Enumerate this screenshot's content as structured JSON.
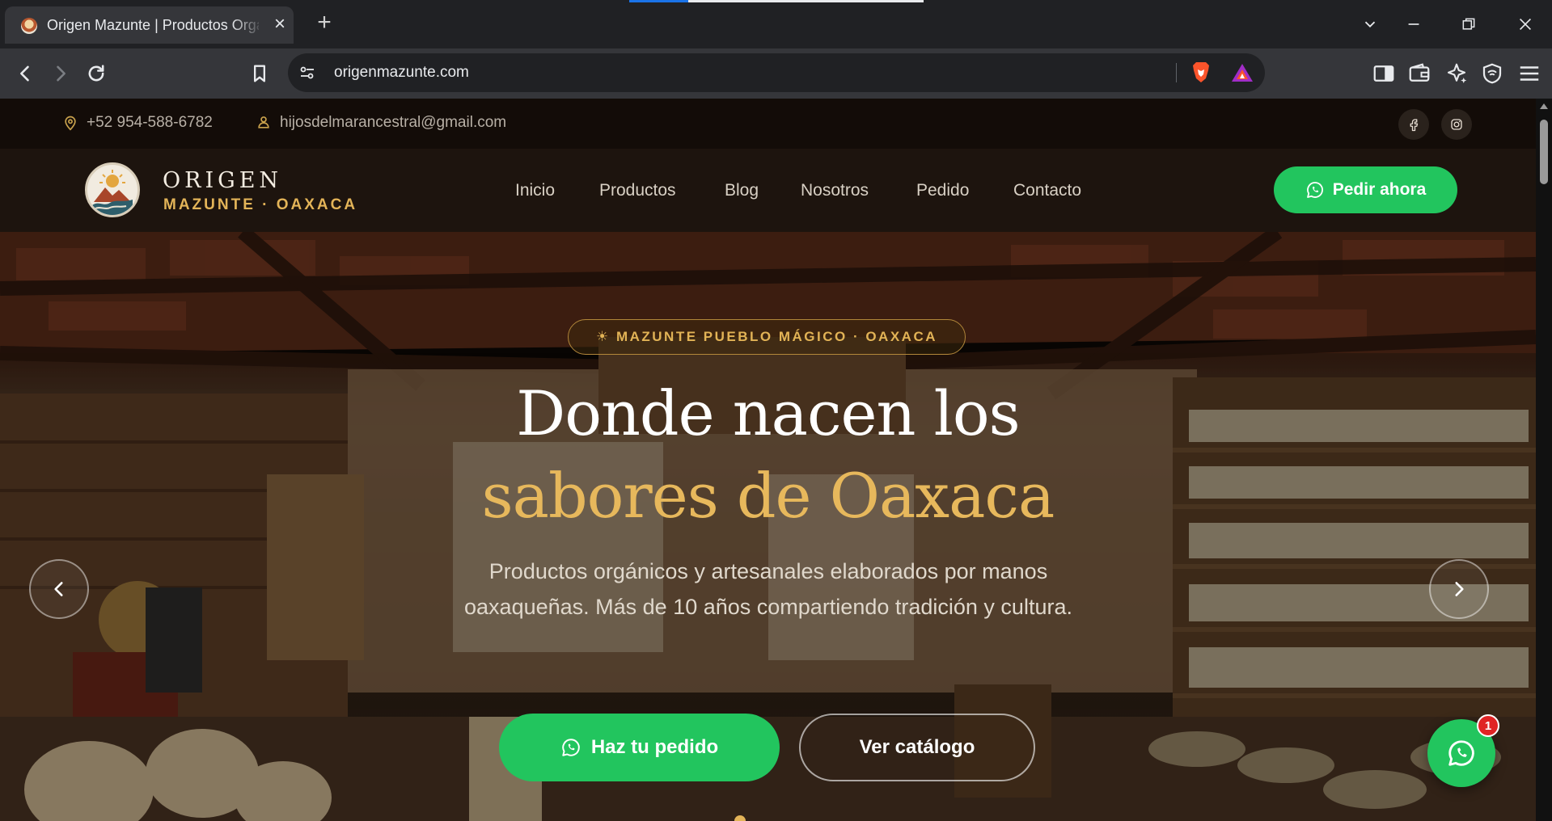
{
  "browser": {
    "tab_title": "Origen Mazunte | Productos Orgánicos",
    "url": "origenmazunte.com"
  },
  "topbar": {
    "phone": "+52 954-588-6782",
    "email": "hijosdelmarancestral@gmail.com",
    "social": [
      "facebook-icon",
      "instagram-icon"
    ]
  },
  "header": {
    "brand_name": "ORIGEN",
    "brand_sub": "MAZUNTE · OAXACA",
    "nav": [
      "Inicio",
      "Productos",
      "Blog",
      "Nosotros",
      "Pedido",
      "Contacto"
    ],
    "cta": "Pedir ahora"
  },
  "hero": {
    "badge": "☀ MAZUNTE PUEBLO MÁGICO · OAXACA",
    "title_line1": "Donde nacen los",
    "title_line2": "sabores de Oaxaca",
    "description": "Productos orgánicos y artesanales elaborados por manos oaxaqueñas. Más de 10 años compartiendo tradición y cultura.",
    "primary_button": "Haz tu pedido",
    "secondary_button": "Ver catálogo"
  },
  "whatsapp_float": {
    "badge_count": "1"
  },
  "colors": {
    "accent_gold": "#e3b458",
    "whatsapp_green": "#22c55e",
    "header_bg": "#1d140e",
    "topbar_bg": "#130c08"
  }
}
